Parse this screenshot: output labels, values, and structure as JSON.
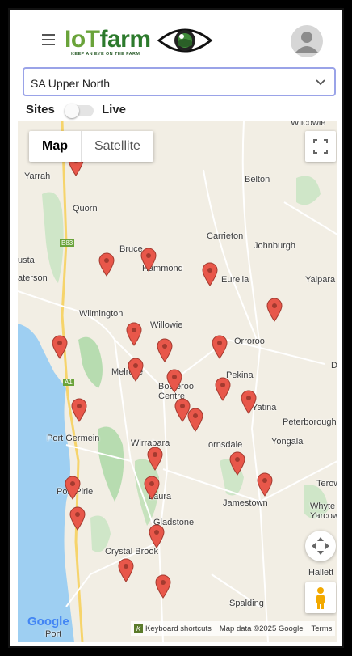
{
  "header": {
    "logo_part1": "IoT",
    "logo_part2": "farm",
    "tagline": "KEEP AN EYE ON THE FARM",
    "menu_icon": "hamburger-menu-icon",
    "avatar_icon": "user-avatar-icon"
  },
  "region": {
    "selected": "SA Upper North",
    "icon": "chevron-down-icon"
  },
  "toggle": {
    "sites_label": "Sites",
    "live_label": "Live",
    "live_on": false
  },
  "map": {
    "type_map": "Map",
    "type_satellite": "Satellite",
    "google_logo": "Google",
    "keyboard_shortcuts": "Keyboard shortcuts",
    "map_data": "Map data ©2025 Google",
    "terms": "Terms",
    "places": [
      "Wilcowie",
      "Yarrah",
      "Belton",
      "Quorn",
      "Carrieton",
      "Bruce",
      "Johnburgh",
      "Hammond",
      "usta",
      "aterson",
      "Eurelia",
      "Yalpara",
      "Wilmington",
      "Willowie",
      "Orroroo",
      "Melrose",
      "Booleroo Centre",
      "Pekina",
      "D",
      "Yatina",
      "Peterborough",
      "Port Germein",
      "Wirrabara",
      "ornsdale",
      "Yongala",
      "Terow",
      "Port Pirie",
      "Laura",
      "Jamestown",
      "Whyte Yarcowie",
      "Gladstone",
      "Crystal Brook",
      "Hallett",
      "Spalding",
      "B83",
      "A1",
      "Port"
    ],
    "pin_count": 31,
    "colors": {
      "pin": "#e8574a",
      "water": "#9ecff2",
      "forest": "#b7dcb0",
      "road": "#ffffff",
      "highway": "#f6d46b",
      "land": "#f2eee4"
    }
  }
}
